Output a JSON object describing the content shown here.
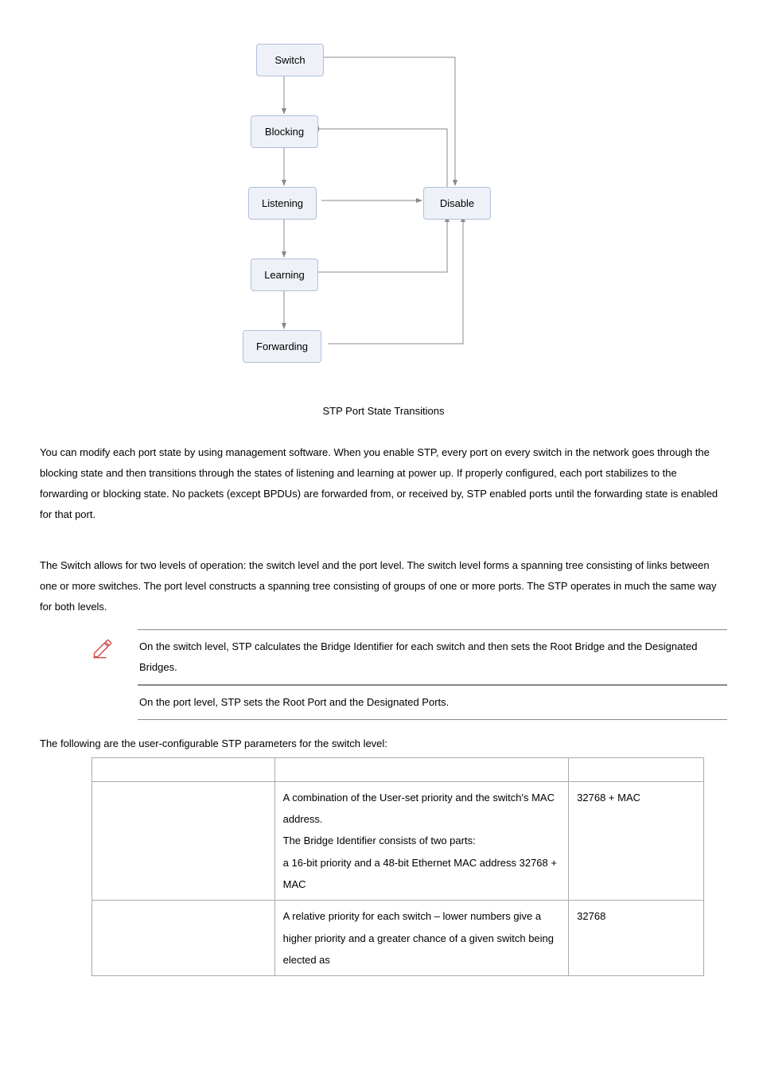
{
  "diagram": {
    "caption": "STP Port State Transitions",
    "nodes": {
      "switch": "Switch",
      "blocking": "Blocking",
      "listening": "Listening",
      "disable": "Disable",
      "learning": "Learning",
      "forwarding": "Forwarding"
    }
  },
  "paragraph1": "You can modify each port state by using management software. When you enable STP, every port on every switch in the network goes through the blocking state and then transitions through the states of listening and learning at power up. If properly configured, each port stabilizes to the forwarding or blocking state. No packets (except BPDUs) are forwarded from, or received by, STP enabled ports until the forwarding state is enabled for that port.",
  "paragraph2": "The Switch allows for two levels of operation: the switch level and the port level. The switch level forms a spanning tree consisting of links between one or more switches. The port level constructs a spanning tree consisting of groups of one or more ports. The STP operates in much the same way for both levels.",
  "note1": "On the switch level, STP calculates the Bridge Identifier for each switch and then sets the Root Bridge and the Designated Bridges.",
  "note2": "On the port level, STP sets the Root Port and the Designated Ports.",
  "tableIntro": "The following are the user-configurable STP parameters for the switch level:",
  "table": {
    "rows": [
      {
        "description": "A combination of the User-set priority and the switch's MAC address.\nThe Bridge Identifier consists of two parts:\na 16-bit priority and a 48-bit Ethernet MAC address 32768 + MAC",
        "default": "32768 + MAC"
      },
      {
        "description": "A relative priority for each switch – lower numbers give a higher priority and a greater chance of a given switch being elected as",
        "default": "32768"
      }
    ]
  }
}
